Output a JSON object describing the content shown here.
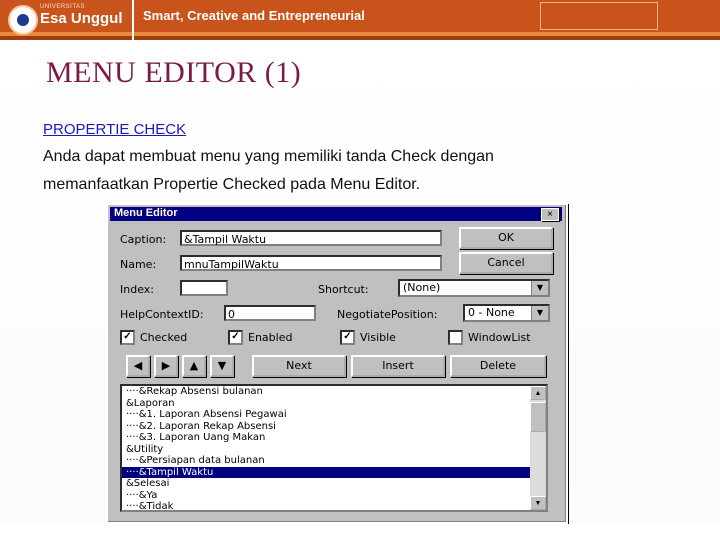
{
  "header": {
    "logo_small_text": "UNIVERSITAS",
    "logo_text": "Esa Unggul",
    "tagline": "Smart, Creative and Entrepreneurial"
  },
  "slide": {
    "title": "MENU  EDITOR  (1)",
    "subhead": "PROPERTIE CHECK",
    "body_lines": [
      "Anda dapat membuat menu yang memiliki tanda Check dengan",
      "memanfaatkan Propertie Checked pada Menu Editor."
    ]
  },
  "dialog": {
    "title": "Menu Editor",
    "close": "×",
    "labels": {
      "caption": "Caption:",
      "name": "Name:",
      "index": "Index:",
      "shortcut": "Shortcut:",
      "helpcontext": "HelpContextID:",
      "negotiate": "NegotiatePosition:",
      "checked": "Checked",
      "enabled": "Enabled",
      "visible": "Visible",
      "windowlist": "WindowList"
    },
    "values": {
      "caption": "&Tampil Waktu",
      "name": "mnuTampilWaktu",
      "index": "",
      "shortcut": "(None)",
      "helpcontext": "0",
      "negotiate": "0 - None"
    },
    "checks": {
      "checked": "✓",
      "enabled": "✓",
      "visible": "✓",
      "windowlist": ""
    },
    "buttons": {
      "ok": "OK",
      "cancel": "Cancel",
      "next": "Next",
      "insert": "Insert",
      "delete": "Delete",
      "arrow_left": "◀",
      "arrow_right": "▶",
      "arrow_up": "▲",
      "arrow_down": "▼"
    },
    "menu_items": [
      "····&Rekap Absensi bulanan",
      "&Laporan",
      "····&1. Laporan Absensi Pegawai",
      "····&2. Laporan Rekap Absensi",
      "····&3. Laporan Uang Makan",
      "&Utility",
      "····&Persiapan data bulanan",
      "····&Tampil Waktu",
      "&Selesai",
      "····&Ya",
      "····&Tidak"
    ],
    "selected_index": 7
  },
  "colors": {
    "banner": "#c8531b",
    "title": "#7b1a48",
    "link": "#1a1ab8",
    "selection": "#000080"
  }
}
